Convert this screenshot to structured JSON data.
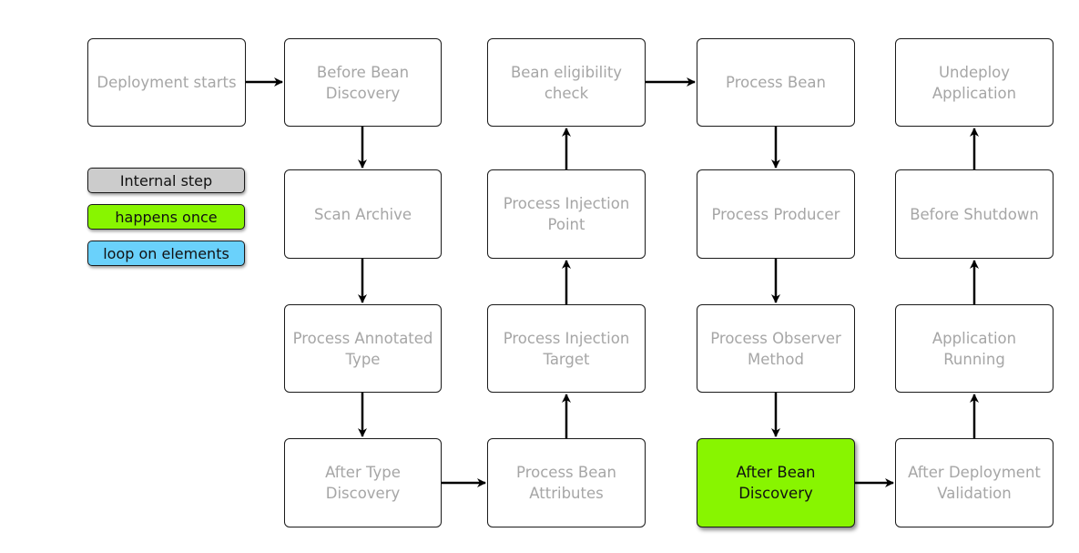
{
  "legend": {
    "internal_step": {
      "label": "Internal step",
      "color": "#cccccc"
    },
    "happens_once": {
      "label": "happens once",
      "color": "#88f500"
    },
    "loop_on_elements": {
      "label": "loop on elements",
      "color": "#6ad1fb"
    }
  },
  "nodes": {
    "deployment_starts": "Deployment starts",
    "before_bean_discovery": "Before Bean\nDiscovery",
    "scan_archive": "Scan Archive",
    "process_annotated_type": "Process Annotated\nType",
    "after_type_discovery": "After Type\nDiscovery",
    "bean_eligibility_check": "Bean eligibility\ncheck",
    "process_injection_point": "Process Injection\nPoint",
    "process_injection_target": "Process Injection\nTarget",
    "process_bean_attributes": "Process Bean\nAttributes",
    "process_bean": "Process Bean",
    "process_producer": "Process Producer",
    "process_observer_method": "Process Observer\nMethod",
    "after_bean_discovery": "After Bean\nDiscovery",
    "undeploy_application": "Undeploy\nApplication",
    "before_shutdown": "Before Shutdown",
    "application_running": "Application Running",
    "after_deployment_validation": "After Deployment\nValidation"
  },
  "colors": {
    "highlight": "#88f500",
    "muted_text": "#a6a6a6",
    "stroke": "#000000"
  }
}
